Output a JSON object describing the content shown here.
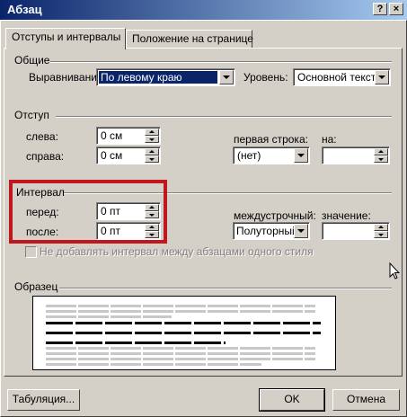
{
  "window": {
    "title": "Абзац",
    "help_btn": "?",
    "close_btn": "×"
  },
  "tabs": [
    {
      "label": "Отступы и интервалы"
    },
    {
      "label": "Положение на странице"
    }
  ],
  "general": {
    "title": "Общие",
    "alignment_label": "Выравнивание:",
    "alignment_value": "По левому краю",
    "level_label": "Уровень:",
    "level_value": "Основной текст"
  },
  "indent": {
    "title": "Отступ",
    "left_label": "слева:",
    "left_value": "0 см",
    "right_label": "справа:",
    "right_value": "0 см",
    "first_line_label": "первая строка:",
    "first_line_value": "(нет)",
    "on_label": "на:",
    "on_value": ""
  },
  "spacing": {
    "title": "Интервал",
    "before_label": "перед:",
    "before_value": "0 пт",
    "after_label": "после:",
    "after_value": "0 пт",
    "line_label": "междустрочный:",
    "line_value": "Полуторный",
    "value_label": "значение:",
    "value_value": "",
    "no_space_checkbox": "Не добавлять интервал между абзацами одного стиля"
  },
  "sample": {
    "title": "Образец"
  },
  "buttons": {
    "tabs": "Табуляция...",
    "ok": "OK",
    "cancel": "Отмена"
  },
  "colors": {
    "highlight_box": "#c0161e",
    "titlebar": "#0a246a",
    "dialog_bg": "#d4d0c8"
  }
}
